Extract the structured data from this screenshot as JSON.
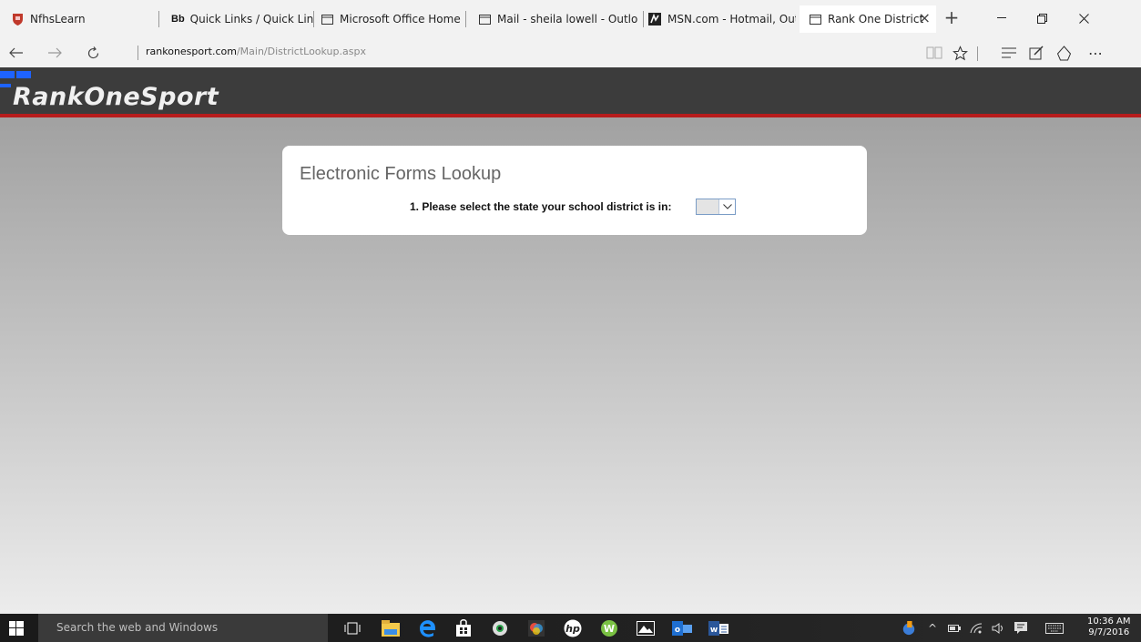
{
  "browser": {
    "tabs": [
      {
        "label": "NfhsLearn",
        "icon": "shield-icon"
      },
      {
        "label": "Quick Links / Quick Links",
        "badge": "Bb",
        "icon": "blackboard-icon"
      },
      {
        "label": "Microsoft Office Home",
        "icon": "page-icon"
      },
      {
        "label": "Mail - sheila lowell - Outlo",
        "icon": "page-icon"
      },
      {
        "label": "MSN.com - Hotmail, Outlc",
        "icon": "msn-icon"
      },
      {
        "label": "Rank One District Forn",
        "icon": "page-icon",
        "active": true
      }
    ],
    "url_host": "rankonesport.com",
    "url_path": "/Main/DistrictLookup.aspx"
  },
  "site": {
    "logo": "RankOneSport"
  },
  "lookup": {
    "title": "Electronic Forms Lookup",
    "prompt": "1. Please select the state your school district is in:",
    "state_value": ""
  },
  "taskbar": {
    "search_placeholder": "Search the web and Windows",
    "time": "10:36 AM",
    "date": "9/7/2016"
  }
}
